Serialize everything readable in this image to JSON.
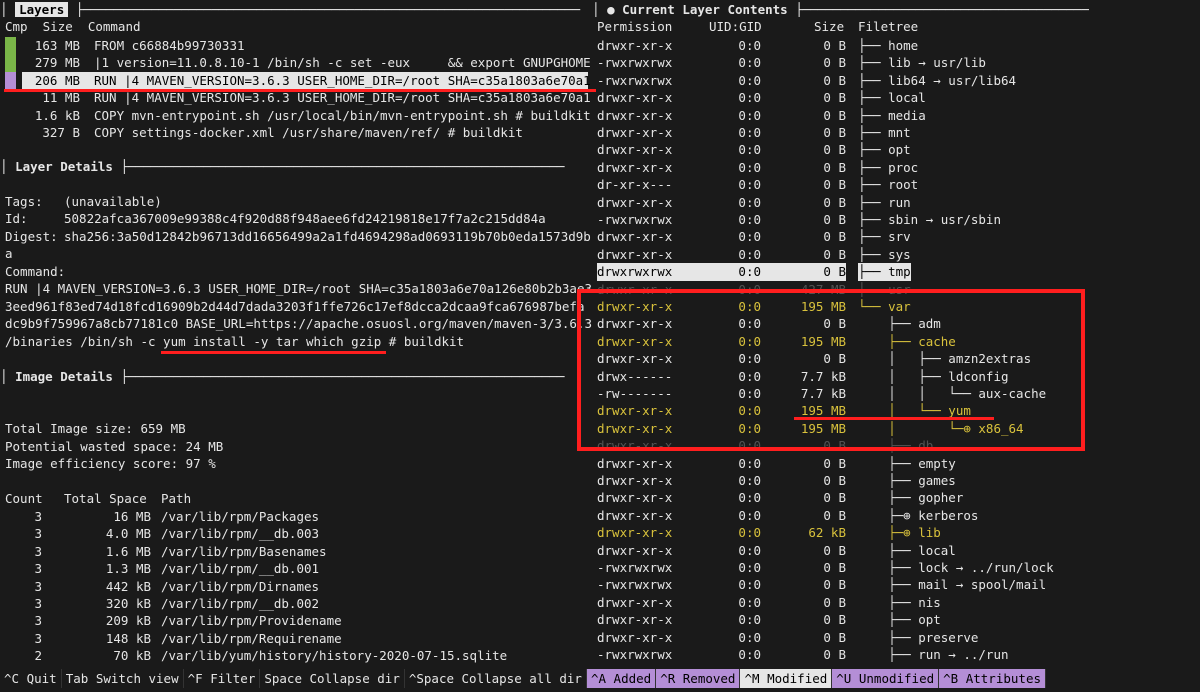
{
  "layers_pane": {
    "title": "Layers",
    "headers": {
      "cmp": "Cmp",
      "size": "Size",
      "command": "Command"
    },
    "rows": [
      {
        "size": "163 MB",
        "command": "FROM c66884b99730331",
        "swatch": "#7ab648"
      },
      {
        "size": "279 MB",
        "command": "|1 version=11.0.8.10-1 /bin/sh -c set -eux     && export GNUPGHOME",
        "swatch": "#7ab648"
      },
      {
        "size": "206 MB",
        "command": "RUN |4 MAVEN_VERSION=3.6.3 USER_HOME_DIR=/root SHA=c35a1803a6e70a1",
        "swatch": "#b48ed6",
        "selected": true
      },
      {
        "size": "11 MB",
        "command": "RUN |4 MAVEN_VERSION=3.6.3 USER_HOME_DIR=/root SHA=c35a1803a6e70a1"
      },
      {
        "size": "1.6 kB",
        "command": "COPY mvn-entrypoint.sh /usr/local/bin/mvn-entrypoint.sh # buildkit"
      },
      {
        "size": "327 B",
        "command": "COPY settings-docker.xml /usr/share/maven/ref/ # buildkit"
      }
    ]
  },
  "layer_details": {
    "title": "Layer Details",
    "tags_label": "Tags:",
    "tags_value": "(unavailable)",
    "id_label": "Id:",
    "id_value": "50822afca367009e99388c4f920d88f948aee6fd24219818e17f7a2c215dd84a",
    "digest_label": "Digest:",
    "digest_value": "sha256:3a50d12842b96713dd16656499a2a1fd4694298ad0693119b70b0eda1573d9b",
    "digest_wrap": "a",
    "command_label": "Command:",
    "command_lines": [
      "RUN |4 MAVEN_VERSION=3.6.3 USER_HOME_DIR=/root SHA=c35a1803a6e70a126e80b2b3ae3",
      "3eed961f83ed74d18fcd16909b2d44d7dada3203f1ffe726c17ef8dcca2dcaa9fca676987befa",
      "dc9b9f759967a8cb77181c0 BASE_URL=https://apache.osuosl.org/maven/maven-3/3.6.3",
      "/binaries /bin/sh -c yum install -y tar which gzip # buildkit"
    ]
  },
  "image_details": {
    "title": "Image Details",
    "total_size": "Total Image size: 659 MB",
    "wasted": "Potential wasted space: 24 MB",
    "efficiency": "Image efficiency score: 97 %",
    "headers": {
      "count": "Count",
      "space": "Total Space",
      "path": "Path"
    },
    "rows": [
      {
        "count": "3",
        "space": "16 MB",
        "path": "/var/lib/rpm/Packages"
      },
      {
        "count": "3",
        "space": "4.0 MB",
        "path": "/var/lib/rpm/__db.003"
      },
      {
        "count": "3",
        "space": "1.6 MB",
        "path": "/var/lib/rpm/Basenames"
      },
      {
        "count": "3",
        "space": "1.3 MB",
        "path": "/var/lib/rpm/__db.001"
      },
      {
        "count": "3",
        "space": "442 kB",
        "path": "/var/lib/rpm/Dirnames"
      },
      {
        "count": "3",
        "space": "320 kB",
        "path": "/var/lib/rpm/__db.002"
      },
      {
        "count": "3",
        "space": "209 kB",
        "path": "/var/lib/rpm/Providename"
      },
      {
        "count": "3",
        "space": "148 kB",
        "path": "/var/lib/rpm/Requirename"
      },
      {
        "count": "2",
        "space": "70 kB",
        "path": "/var/lib/yum/history/history-2020-07-15.sqlite"
      }
    ]
  },
  "contents_pane": {
    "title": "● Current Layer Contents",
    "headers": {
      "perm": "Permission",
      "uid": "UID:GID",
      "size": "Size",
      "tree": "Filetree"
    },
    "rows": [
      {
        "perm": "drwxr-xr-x",
        "uid": "0:0",
        "size": "0 B",
        "tree": "├── home"
      },
      {
        "perm": "-rwxrwxrwx",
        "uid": "0:0",
        "size": "0 B",
        "tree": "├── lib → usr/lib"
      },
      {
        "perm": "-rwxrwxrwx",
        "uid": "0:0",
        "size": "0 B",
        "tree": "├── lib64 → usr/lib64"
      },
      {
        "perm": "drwxr-xr-x",
        "uid": "0:0",
        "size": "0 B",
        "tree": "├── local"
      },
      {
        "perm": "drwxr-xr-x",
        "uid": "0:0",
        "size": "0 B",
        "tree": "├── media"
      },
      {
        "perm": "drwxr-xr-x",
        "uid": "0:0",
        "size": "0 B",
        "tree": "├── mnt"
      },
      {
        "perm": "drwxr-xr-x",
        "uid": "0:0",
        "size": "0 B",
        "tree": "├── opt"
      },
      {
        "perm": "drwxr-xr-x",
        "uid": "0:0",
        "size": "0 B",
        "tree": "├── proc"
      },
      {
        "perm": "dr-xr-x---",
        "uid": "0:0",
        "size": "0 B",
        "tree": "├── root"
      },
      {
        "perm": "drwxr-xr-x",
        "uid": "0:0",
        "size": "0 B",
        "tree": "├── run"
      },
      {
        "perm": "-rwxrwxrwx",
        "uid": "0:0",
        "size": "0 B",
        "tree": "├── sbin → usr/sbin"
      },
      {
        "perm": "drwxr-xr-x",
        "uid": "0:0",
        "size": "0 B",
        "tree": "├── srv"
      },
      {
        "perm": "drwxr-xr-x",
        "uid": "0:0",
        "size": "0 B",
        "tree": "├── sys"
      },
      {
        "perm": "drwxrwxrwx",
        "uid": "0:0",
        "size": "0 B",
        "tree": "├── tmp",
        "selected": true
      },
      {
        "perm": "drwxr-xr-x",
        "uid": "0:0",
        "size": "427 MB",
        "tree": "├── usr",
        "hidden": true
      },
      {
        "perm": "drwxr-xr-x",
        "uid": "0:0",
        "size": "195 MB",
        "tree": "└── var",
        "yellow": true
      },
      {
        "perm": "drwxr-xr-x",
        "uid": "0:0",
        "size": "0 B",
        "tree": "    ├── adm"
      },
      {
        "perm": "drwxr-xr-x",
        "uid": "0:0",
        "size": "195 MB",
        "tree": "    ├── cache",
        "yellow": true
      },
      {
        "perm": "drwxr-xr-x",
        "uid": "0:0",
        "size": "0 B",
        "tree": "    │   ├── amzn2extras"
      },
      {
        "perm": "drwx------",
        "uid": "0:0",
        "size": "7.7 kB",
        "tree": "    │   ├── ldconfig"
      },
      {
        "perm": "-rw-------",
        "uid": "0:0",
        "size": "7.7 kB",
        "tree": "    │   │   └── aux-cache"
      },
      {
        "perm": "drwxr-xr-x",
        "uid": "0:0",
        "size": "195 MB",
        "tree": "    │   └── yum",
        "yellow": true
      },
      {
        "perm": "drwxr-xr-x",
        "uid": "0:0",
        "size": "195 MB",
        "tree": "    │       └─⊕ x86_64",
        "yellow": true
      },
      {
        "perm": "drwxr-xr-x",
        "uid": "0:0",
        "size": "0 B",
        "tree": "    ├── db",
        "hidden": true
      },
      {
        "perm": "drwxr-xr-x",
        "uid": "0:0",
        "size": "0 B",
        "tree": "    ├── empty"
      },
      {
        "perm": "drwxr-xr-x",
        "uid": "0:0",
        "size": "0 B",
        "tree": "    ├── games"
      },
      {
        "perm": "drwxr-xr-x",
        "uid": "0:0",
        "size": "0 B",
        "tree": "    ├── gopher"
      },
      {
        "perm": "drwxr-xr-x",
        "uid": "0:0",
        "size": "0 B",
        "tree": "    ├─⊕ kerberos"
      },
      {
        "perm": "drwxr-xr-x",
        "uid": "0:0",
        "size": "62 kB",
        "tree": "    ├─⊕ lib",
        "yellow": true
      },
      {
        "perm": "drwxr-xr-x",
        "uid": "0:0",
        "size": "0 B",
        "tree": "    ├── local"
      },
      {
        "perm": "-rwxrwxrwx",
        "uid": "0:0",
        "size": "0 B",
        "tree": "    ├── lock → ../run/lock"
      },
      {
        "perm": "-rwxrwxrwx",
        "uid": "0:0",
        "size": "0 B",
        "tree": "    ├── mail → spool/mail"
      },
      {
        "perm": "drwxr-xr-x",
        "uid": "0:0",
        "size": "0 B",
        "tree": "    ├── nis"
      },
      {
        "perm": "drwxr-xr-x",
        "uid": "0:0",
        "size": "0 B",
        "tree": "    ├── opt"
      },
      {
        "perm": "drwxr-xr-x",
        "uid": "0:0",
        "size": "0 B",
        "tree": "    ├── preserve"
      },
      {
        "perm": "-rwxrwxrwx",
        "uid": "0:0",
        "size": "0 B",
        "tree": "    ├── run → ../run"
      }
    ]
  },
  "statusbar": [
    {
      "key": "^C",
      "label": "Quit"
    },
    {
      "key": "Tab",
      "label": "Switch view"
    },
    {
      "key": "^F",
      "label": "Filter"
    },
    {
      "key": "Space",
      "label": "Collapse dir"
    },
    {
      "key": "^Space",
      "label": "Collapse all dir"
    },
    {
      "key": "^A",
      "label": "Added",
      "style": "pur"
    },
    {
      "key": "^R",
      "label": "Removed",
      "style": "pur"
    },
    {
      "key": "^M",
      "label": "Modified",
      "style": "on"
    },
    {
      "key": "^U",
      "label": "Unmodified",
      "style": "pur"
    },
    {
      "key": "^B",
      "label": "Attributes",
      "style": "pur"
    }
  ],
  "colors": {
    "accent": "#ff1e1e",
    "swatch_green": "#7ab648",
    "swatch_purple": "#b48ed6",
    "modified": "#d9c23c"
  }
}
